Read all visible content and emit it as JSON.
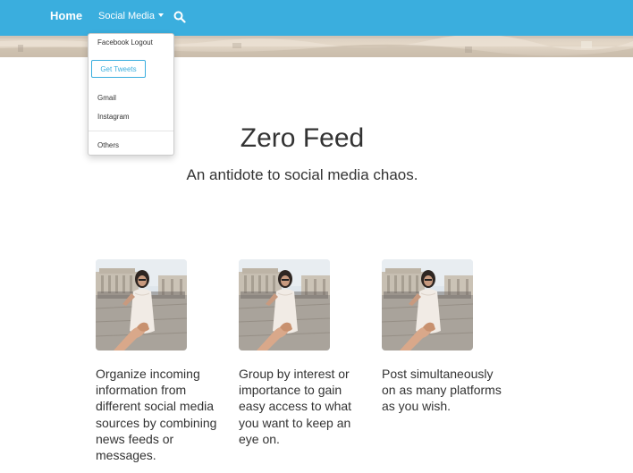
{
  "navbar": {
    "home_label": "Home",
    "social_label": "Social Media",
    "search_icon": "search-icon",
    "background_color": "#3aaede"
  },
  "dropdown": {
    "facebook_logout": "Facebook Logout",
    "get_tweets": "Get Tweets",
    "gmail": "Gmail",
    "instagram": "Instagram",
    "others": "Others"
  },
  "hero": {
    "title": "Zero Feed",
    "subtitle": "An antidote to social media chaos."
  },
  "features": [
    {
      "text": "Organize incoming information from different social media sources by combining news feeds or messages."
    },
    {
      "text": "Group by interest or importance to gain easy access to what you want to keep an eye on."
    },
    {
      "text": "Post simultaneously on as many platforms as you wish."
    }
  ]
}
